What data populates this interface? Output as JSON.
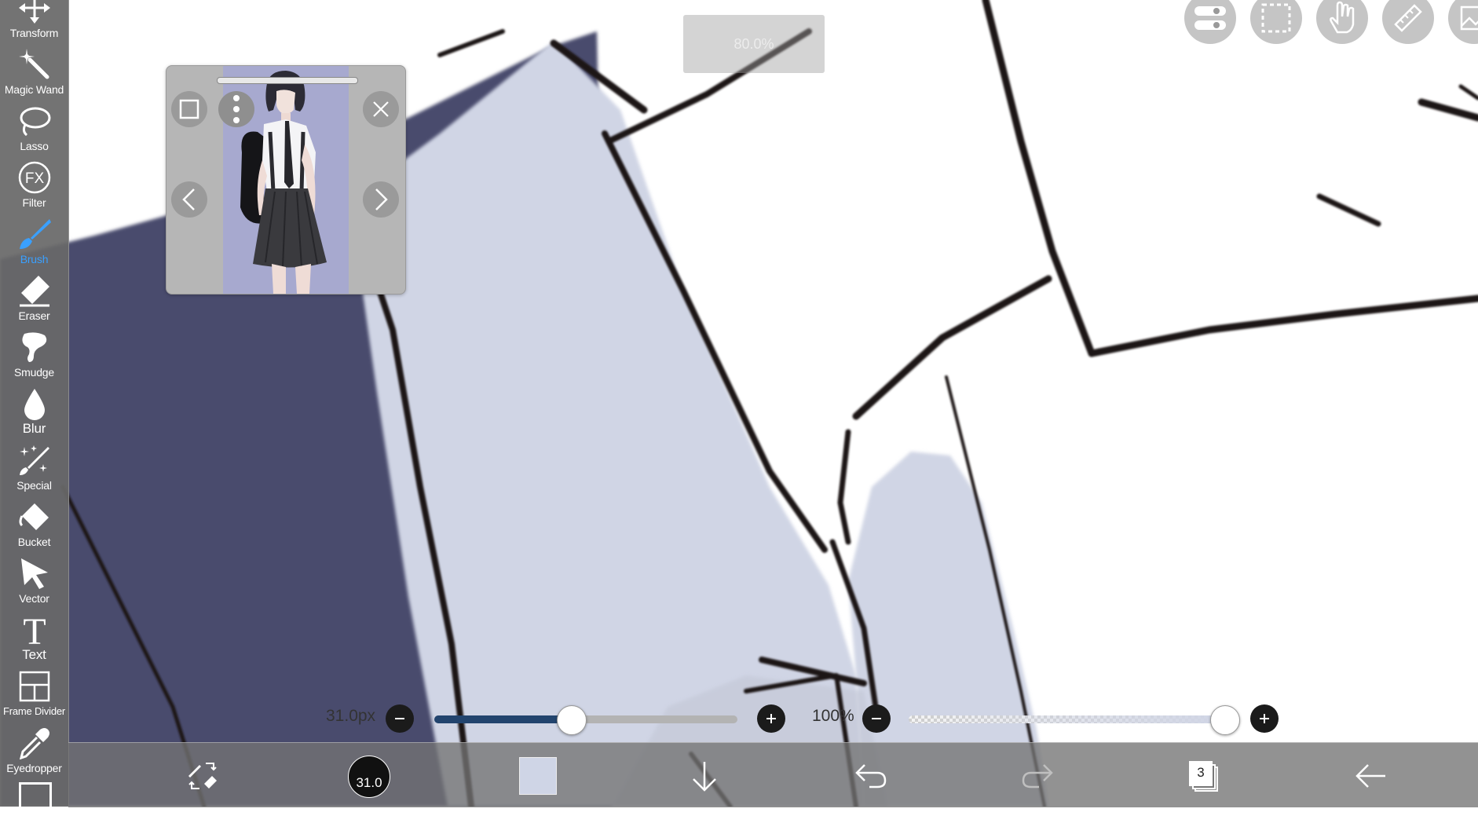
{
  "toolbar": {
    "tools": [
      {
        "id": "transform",
        "label": "Transform",
        "icon": "move-arrows-icon"
      },
      {
        "id": "magic-wand",
        "label": "Magic Wand",
        "icon": "magic-wand-icon"
      },
      {
        "id": "lasso",
        "label": "Lasso",
        "icon": "lasso-icon"
      },
      {
        "id": "filter",
        "label": "Filter",
        "icon": "fx-icon"
      },
      {
        "id": "brush",
        "label": "Brush",
        "icon": "brush-icon",
        "active": true
      },
      {
        "id": "eraser",
        "label": "Eraser",
        "icon": "eraser-icon"
      },
      {
        "id": "smudge",
        "label": "Smudge",
        "icon": "smudge-icon"
      },
      {
        "id": "blur",
        "label": "Blur",
        "icon": "droplet-icon"
      },
      {
        "id": "special",
        "label": "Special",
        "icon": "sparkle-brush-icon"
      },
      {
        "id": "bucket",
        "label": "Bucket",
        "icon": "bucket-icon"
      },
      {
        "id": "vector",
        "label": "Vector",
        "icon": "cursor-arrow-icon"
      },
      {
        "id": "text",
        "label": "Text",
        "icon": "text-t-icon"
      },
      {
        "id": "frame-divider",
        "label": "Frame Divider",
        "icon": "frame-divider-icon"
      },
      {
        "id": "eyedropper",
        "label": "Eyedropper",
        "icon": "eyedropper-icon"
      }
    ],
    "active_color": "#3aa0ff"
  },
  "zoom": {
    "text": "80.0%"
  },
  "brush_size": {
    "label": "31.0px",
    "fraction": 0.45
  },
  "opacity": {
    "label": "100%",
    "fraction": 1.0
  },
  "bottom_bar": {
    "brush_size_display": "31.0",
    "current_color": "#cfd5e6",
    "layer_count": "3"
  },
  "canvas_colors": {
    "navy": "#4a4b6d",
    "light_blue": "#d0d5e5",
    "line": "#1d1716",
    "paper": "#ffffff"
  }
}
